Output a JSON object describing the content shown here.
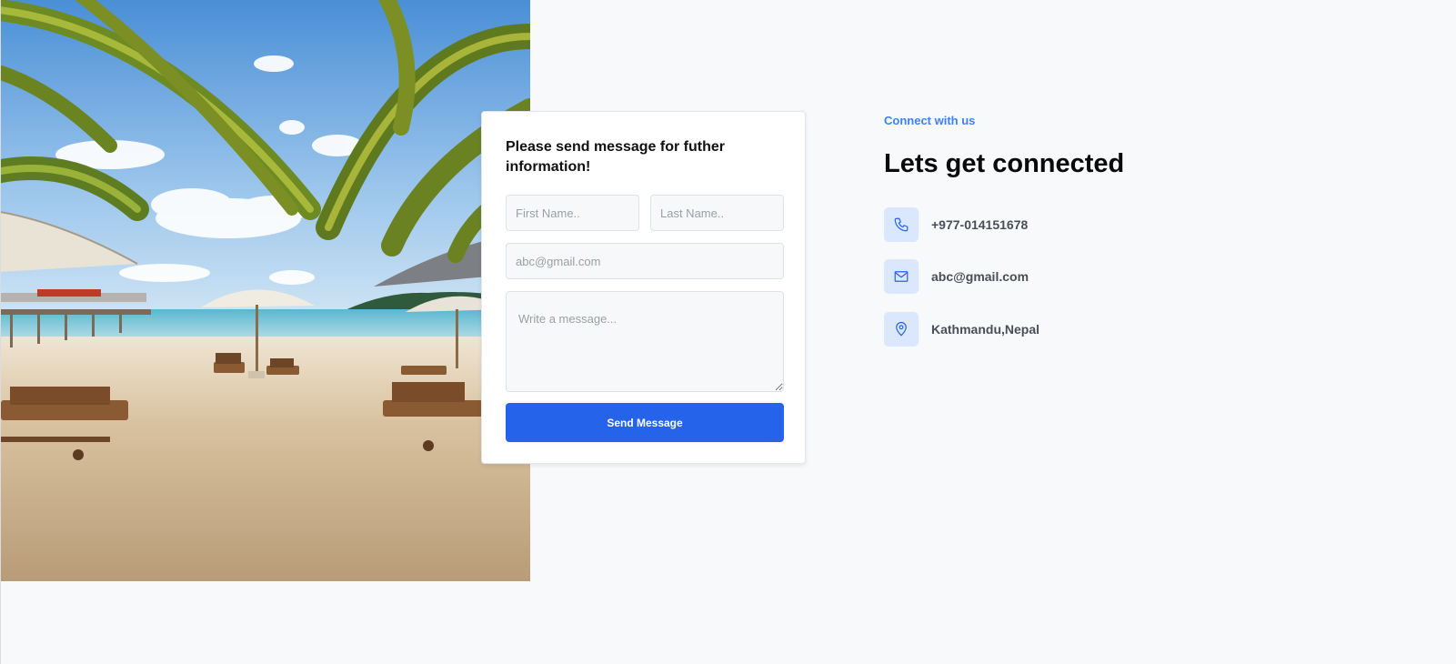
{
  "form": {
    "title": "Please send message for futher information!",
    "first_name_placeholder": "First Name..",
    "last_name_placeholder": "Last Name..",
    "email_placeholder": "abc@gmail.com",
    "message_placeholder": "Write a message...",
    "submit_label": "Send Message"
  },
  "info": {
    "eyebrow": "Connect with us",
    "heading": "Lets get connected",
    "contacts": [
      {
        "icon": "phone-icon",
        "text": "+977-014151678"
      },
      {
        "icon": "mail-icon",
        "text": "abc@gmail.com"
      },
      {
        "icon": "location-pin-icon",
        "text": "Kathmandu,Nepal"
      }
    ]
  },
  "colors": {
    "accent": "#2563eb",
    "eyebrow": "#3b82f6",
    "icon_bg": "#dbe7fd",
    "page_bg": "#f8f9fb"
  }
}
